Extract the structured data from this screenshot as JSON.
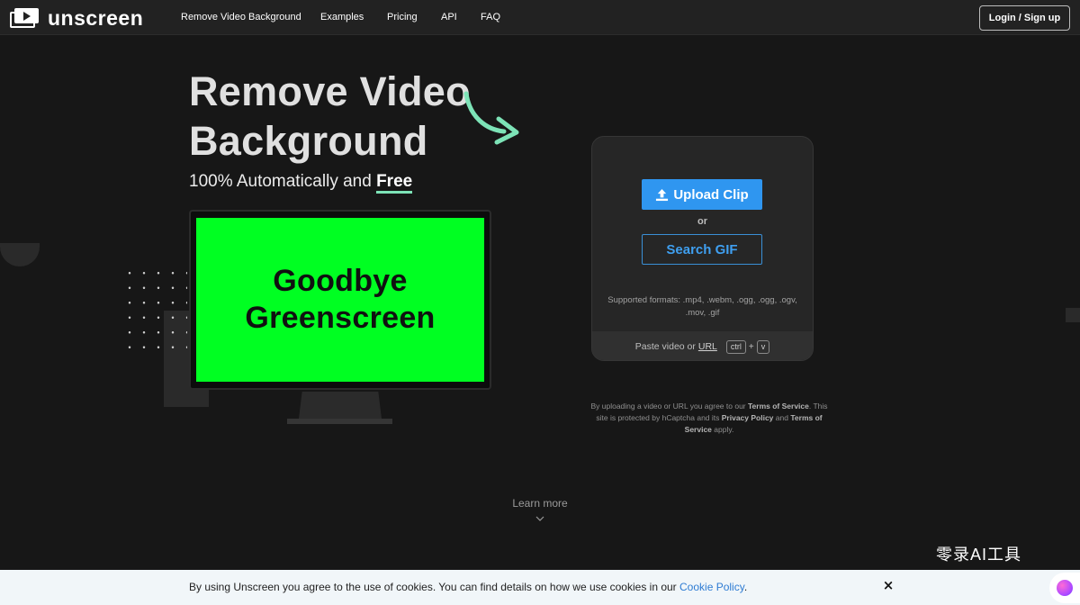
{
  "nav": {
    "logo_text": "unscreen",
    "links": [
      "Remove Video Background",
      "Examples",
      "Pricing",
      "API",
      "FAQ"
    ],
    "login_label": "Login / Sign up"
  },
  "hero": {
    "title_line1": "Remove Video",
    "title_line2": "Background",
    "subtitle_prefix": "100% Automatically and",
    "subtitle_emphasis": "Free",
    "screen_line1": "Goodbye",
    "screen_line2": "Greenscreen"
  },
  "upload": {
    "upload_label": "Upload Clip",
    "or_label": "or",
    "search_label": "Search GIF",
    "formats": "Supported formats: .mp4, .webm, .ogg, .ogg, .ogv, .mov, .gif",
    "paste_prefix": "Paste video or",
    "paste_url": "URL",
    "key_ctrl": "ctrl",
    "key_plus": "+",
    "key_v": "v"
  },
  "legal": {
    "p1": "By uploading a video or URL you agree to our",
    "terms": "Terms of Service",
    "p2": ". This site is protected by hCaptcha and its",
    "privacy": "Privacy Policy",
    "p3": "and",
    "terms2": "Terms of Service",
    "p4": "apply."
  },
  "learn_more": "Learn more",
  "watermark": "零录AI工具",
  "cookie": {
    "text": "By using Unscreen you agree to the use of cookies. You can find details on how we use cookies in our",
    "link": "Cookie Policy",
    "period": ".",
    "close": "×"
  },
  "colors": {
    "accent_blue": "#2f96f0",
    "accent_green": "#7de3b7",
    "greenscreen": "#00ff22",
    "background": "#171717"
  },
  "icons": [
    "play-logo-icon",
    "upload-icon",
    "curved-arrow-icon",
    "chevron-down-icon",
    "close-icon"
  ]
}
